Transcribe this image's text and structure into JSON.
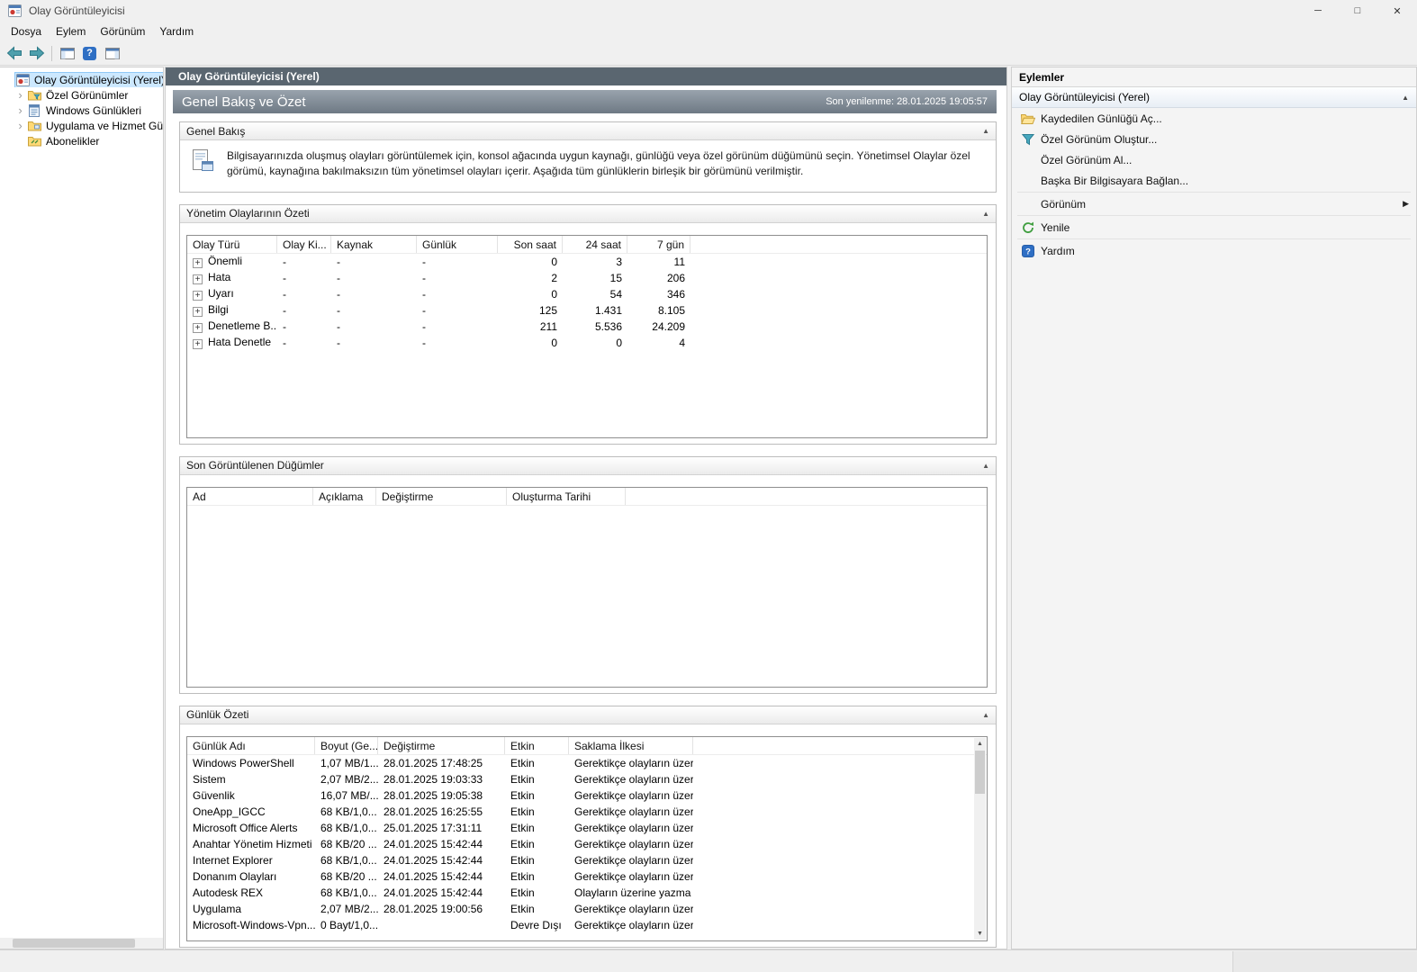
{
  "window": {
    "title": "Olay Görüntüleyicisi"
  },
  "menu": {
    "items": [
      "Dosya",
      "Eylem",
      "Görünüm",
      "Yardım"
    ]
  },
  "tree": {
    "items": [
      {
        "label": "Olay Görüntüleyicisi (Yerel)",
        "icon": "event-viewer-icon",
        "selected": true,
        "expander": false,
        "indent": 0
      },
      {
        "label": "Özel Görünümler",
        "icon": "custom-views-folder-icon",
        "selected": false,
        "expander": true,
        "indent": 1
      },
      {
        "label": "Windows Günlükleri",
        "icon": "windows-logs-icon",
        "selected": false,
        "expander": true,
        "indent": 1
      },
      {
        "label": "Uygulama ve Hizmet Günlükleri",
        "icon": "app-service-logs-folder-icon",
        "selected": false,
        "expander": true,
        "indent": 1
      },
      {
        "label": "Abonelikler",
        "icon": "subscriptions-icon",
        "selected": false,
        "expander": false,
        "indent": 1
      }
    ]
  },
  "center": {
    "breadcrumb": "Olay Görüntüleyicisi (Yerel)",
    "banner": {
      "title": "Genel Bakış ve Özet",
      "refresh": "Son yenilenme: 28.01.2025 19:05:57"
    },
    "overview": {
      "header": "Genel Bakış",
      "text": "Bilgisayarınızda oluşmuş olayları görüntülemek için, konsol ağacında uygun kaynağı, günlüğü veya özel görünüm düğümünü seçin. Yönetimsel Olaylar özel görümü, kaynağına bakılmaksızın tüm yönetimsel olayları içerir. Aşağıda tüm günlüklerin birleşik bir görümünü verilmiştir."
    },
    "admin_summary": {
      "header": "Yönetim Olaylarının Özeti",
      "columns": [
        "Olay Türü",
        "Olay Ki...",
        "Kaynak",
        "Günlük",
        "Son saat",
        "24 saat",
        "7 gün"
      ],
      "rows": [
        [
          "Önemli",
          "-",
          "-",
          "-",
          "0",
          "3",
          "11"
        ],
        [
          "Hata",
          "-",
          "-",
          "-",
          "2",
          "15",
          "206"
        ],
        [
          "Uyarı",
          "-",
          "-",
          "-",
          "0",
          "54",
          "346"
        ],
        [
          "Bilgi",
          "-",
          "-",
          "-",
          "125",
          "1.431",
          "8.105"
        ],
        [
          "Denetleme B...",
          "-",
          "-",
          "-",
          "211",
          "5.536",
          "24.209"
        ],
        [
          "Hata Denetle",
          "-",
          "-",
          "-",
          "0",
          "0",
          "4"
        ]
      ]
    },
    "recent_nodes": {
      "header": "Son Görüntülenen Düğümler",
      "columns": [
        "Ad",
        "Açıklama",
        "Değiştirme",
        "Oluşturma Tarihi"
      ],
      "rows": []
    },
    "log_summary": {
      "header": "Günlük Özeti",
      "columns": [
        "Günlük Adı",
        "Boyut (Ge...",
        "Değiştirme",
        "Etkin",
        "Saklama İlkesi"
      ],
      "rows": [
        [
          "Windows PowerShell",
          "1,07 MB/1...",
          "28.01.2025 17:48:25",
          "Etkin",
          "Gerektikçe olayların üzer..."
        ],
        [
          "Sistem",
          "2,07 MB/2...",
          "28.01.2025 19:03:33",
          "Etkin",
          "Gerektikçe olayların üzer..."
        ],
        [
          "Güvenlik",
          "16,07 MB/...",
          "28.01.2025 19:05:38",
          "Etkin",
          "Gerektikçe olayların üzer..."
        ],
        [
          "OneApp_IGCC",
          "68 KB/1,0...",
          "28.01.2025 16:25:55",
          "Etkin",
          "Gerektikçe olayların üzer..."
        ],
        [
          "Microsoft Office Alerts",
          "68 KB/1,0...",
          "25.01.2025 17:31:11",
          "Etkin",
          "Gerektikçe olayların üzer..."
        ],
        [
          "Anahtar Yönetim Hizmeti",
          "68 KB/20 ...",
          "24.01.2025 15:42:44",
          "Etkin",
          "Gerektikçe olayların üzer..."
        ],
        [
          "Internet Explorer",
          "68 KB/1,0...",
          "24.01.2025 15:42:44",
          "Etkin",
          "Gerektikçe olayların üzer..."
        ],
        [
          "Donanım Olayları",
          "68 KB/20 ...",
          "24.01.2025 15:42:44",
          "Etkin",
          "Gerektikçe olayların üzer..."
        ],
        [
          "Autodesk REX",
          "68 KB/1,0...",
          "24.01.2025 15:42:44",
          "Etkin",
          "Olayların üzerine yazma ..."
        ],
        [
          "Uygulama",
          "2,07 MB/2...",
          "28.01.2025 19:00:56",
          "Etkin",
          "Gerektikçe olayların üzer..."
        ],
        [
          "Microsoft-Windows-Vpn...",
          "0 Bayt/1,0...",
          "",
          "Devre Dışı",
          "Gerektikçe olayların üzer..."
        ]
      ]
    }
  },
  "actions": {
    "title": "Eylemler",
    "section": "Olay Görüntüleyicisi (Yerel)",
    "items": [
      {
        "label": "Kaydedilen Günlüğü Aç...",
        "icon": "open-saved-log-icon",
        "submenu": false,
        "separator_after": false
      },
      {
        "label": "Özel Görünüm Oluştur...",
        "icon": "create-custom-view-icon",
        "submenu": false,
        "separator_after": false
      },
      {
        "label": "Özel Görünüm Al...",
        "icon": null,
        "submenu": false,
        "separator_after": false
      },
      {
        "label": "Başka Bir Bilgisayara Bağlan...",
        "icon": null,
        "submenu": false,
        "separator_after": true
      },
      {
        "label": "Görünüm",
        "icon": null,
        "submenu": true,
        "separator_after": true
      },
      {
        "label": "Yenile",
        "icon": "refresh-icon",
        "submenu": false,
        "separator_after": true
      },
      {
        "label": "Yardım",
        "icon": "help-icon",
        "submenu": false,
        "separator_after": false
      }
    ]
  }
}
